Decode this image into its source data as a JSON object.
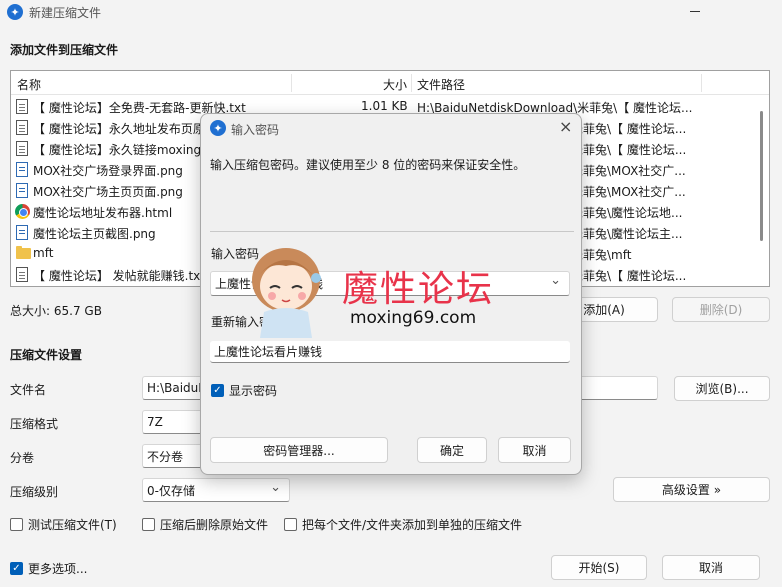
{
  "window": {
    "title": "新建压缩文件"
  },
  "main": {
    "section_title": "添加文件到压缩文件",
    "columns": {
      "name": "名称",
      "size": "大小",
      "path": "文件路径"
    },
    "files": [
      {
        "name": "【 魔性论坛】全免费-无套路-更新快.txt",
        "size": "1.01 KB",
        "path": "H:\\BaiduNetdiskDownload\\米菲兔\\【 魔性论坛...",
        "icon": "text-file-icon"
      },
      {
        "name": "【 魔性论坛】永久地址发布页原",
        "size": "",
        "path": "米菲兔\\【 魔性论坛...",
        "icon": "text-file-icon"
      },
      {
        "name": "【 魔性论坛】永久链接moxing",
        "size": "",
        "path": "米菲兔\\【 魔性论坛...",
        "icon": "text-file-icon"
      },
      {
        "name": "MOX社交广场登录界面.png",
        "size": "",
        "path": "米菲兔\\MOX社交广...",
        "icon": "image-file-icon"
      },
      {
        "name": "MOX社交广场主页页面.png",
        "size": "",
        "path": "米菲兔\\MOX社交广...",
        "icon": "image-file-icon"
      },
      {
        "name": "魔性论坛地址发布器.html",
        "size": "",
        "path": "米菲兔\\魔性论坛地...",
        "icon": "chrome-icon"
      },
      {
        "name": "魔性论坛主页截图.png",
        "size": "",
        "path": "米菲兔\\魔性论坛主...",
        "icon": "image-file-icon"
      },
      {
        "name": "mft",
        "size": "",
        "path": "米菲兔\\mft",
        "icon": "folder-icon"
      },
      {
        "name": "【 魔性论坛】 发帖就能赚钱.tx",
        "size": "",
        "path": "米菲兔\\【 魔性论坛...",
        "icon": "text-file-icon"
      }
    ],
    "total_size": "总大小: 65.7 GB",
    "add_button": "添加(A)",
    "delete_button": "删除(D)",
    "settings_title": "压缩文件设置",
    "filename_label": "文件名",
    "filename_value": "H:\\BaiduN",
    "browse_button": "浏览(B)...",
    "format_label": "压缩格式",
    "format_value": "7Z",
    "split_label": "分卷",
    "split_value": "不分卷",
    "level_label": "压缩级别",
    "level_value": "0-仅存储",
    "advanced_button": "高级设置 »",
    "options": {
      "test": "测试压缩文件(T)",
      "delete_after": "压缩后删除原始文件",
      "separate": "把每个文件/文件夹添加到单独的压缩文件"
    },
    "more_options": "更多选项...",
    "start_button": "开始(S)",
    "cancel_button": "取消"
  },
  "dialog": {
    "title": "输入密码",
    "description": "输入压缩包密码。建议使用至少 8 位的密码来保证安全性。",
    "password_label": "输入密码",
    "password_value": "上魔性论坛看片赚钱",
    "reenter_label": "重新输入密码",
    "reenter_value": "上魔性论坛看片赚钱",
    "show_password": "显示密码",
    "manager_button": "密码管理器...",
    "ok_button": "确定",
    "cancel_button": "取消"
  },
  "watermark": {
    "text": "魔性论坛",
    "url": "moxing69.com"
  },
  "colors": {
    "accent": "#005fb8",
    "watermark": "#e8334a"
  }
}
